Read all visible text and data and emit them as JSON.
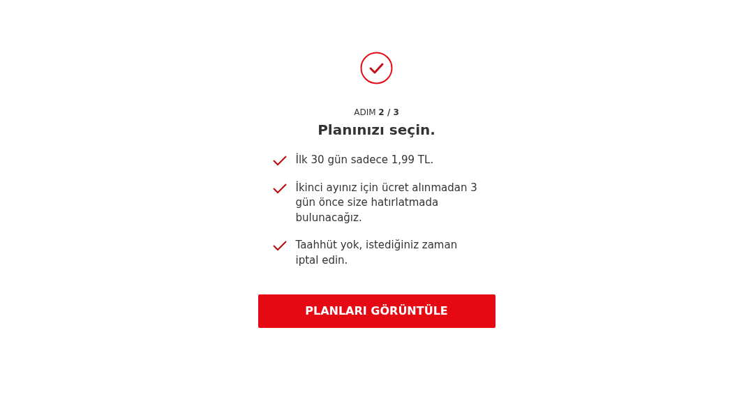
{
  "step_indicator": "ADIM **2 / 3**",
  "title": "Planınızı seçin.",
  "benefits": [
    "İlk 30 gün sadece 1,99 TL.",
    "İkinci ayınız için ücret alınmadan 3 gün önce size hatırlatmada bulunacağız.",
    "Taahhüt yok, istediğiniz zaman iptal edin."
  ],
  "button": "PLANLARI GÖRÜNTÜLE"
}
